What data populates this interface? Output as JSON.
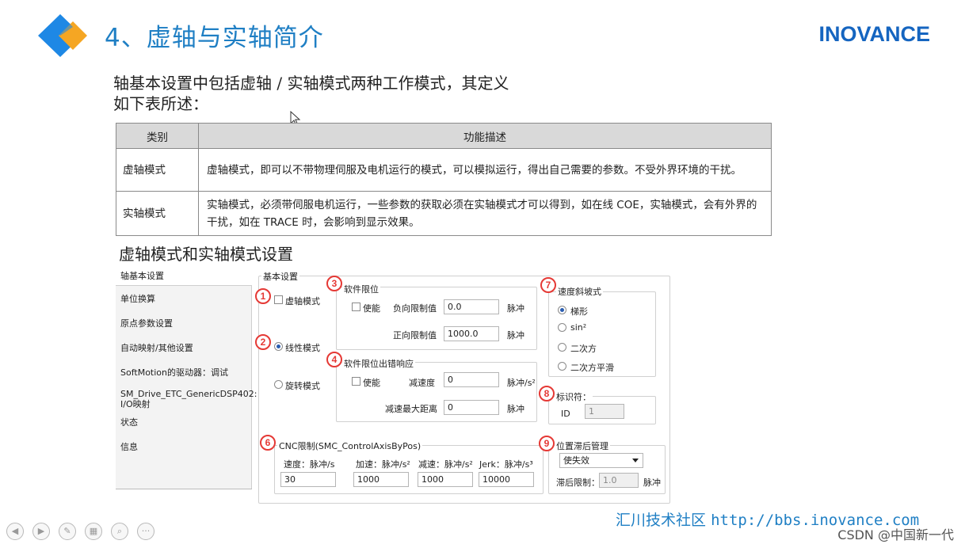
{
  "slide": {
    "title": "4、虚轴与实轴简介",
    "brand": "INOVANCE",
    "intro_line1": "轴基本设置中包括虚轴 / 实轴模式两种工作模式，其定义",
    "intro_line2": "如下表所述：",
    "subtitle": "虚轴模式和实轴模式设置",
    "footer_text": "汇川技术社区",
    "footer_url": "http://bbs.inovance.com",
    "watermark": "CSDN @中国新一代",
    "colors": {
      "title": "#1f7fc4",
      "brand": "#1565c0",
      "diamond_blue": "#1e88e5",
      "diamond_orange": "#f5a623",
      "badge": "#e53935"
    }
  },
  "table": {
    "headers": [
      "类别",
      "功能描述"
    ],
    "rows": [
      {
        "category": "虚轴模式",
        "desc": "虚轴模式，即可以不带物理伺服及电机运行的模式，可以模拟运行，得出自己需要的参数。不受外界环境的干扰。"
      },
      {
        "category": "实轴模式",
        "desc": "实轴模式，必须带伺服电机运行，一些参数的获取必须在实轴模式才可以得到，如在线 COE，实轴模式，会有外界的干扰，如在 TRACE 时，会影响到显示效果。"
      }
    ]
  },
  "settings": {
    "nav_header": "轴基本设置",
    "nav_items": [
      "单位换算",
      "原点参数设置",
      "自动映射/其他设置",
      "SoftMotion的驱动器：调试",
      "SM_Drive_ETC_GenericDSP402: I/O映射",
      "状态",
      "信息"
    ],
    "basic_legend": "基本设置",
    "virtual_mode": "虚轴模式",
    "linear_mode": "线性模式",
    "rotary_mode": "旋转模式",
    "soft_limit": {
      "legend": "软件限位",
      "enable": "使能",
      "neg_label": "负向限制值",
      "neg_value": "0.0",
      "pos_label": "正向限制值",
      "pos_value": "1000.0",
      "unit": "脉冲"
    },
    "limit_error": {
      "legend": "软件限位出错响应",
      "enable": "使能",
      "decel_label": "减速度",
      "decel_value": "0",
      "decel_unit": "脉冲/s²",
      "maxdist_label": "减速最大距离",
      "maxdist_value": "0",
      "maxdist_unit": "脉冲"
    },
    "ramp": {
      "legend": "速度斜坡式",
      "options": [
        "梯形",
        "sin²",
        "二次方",
        "二次方平滑"
      ],
      "selected": 0
    },
    "identifier": {
      "legend": "标识符：",
      "id_label": "ID",
      "id_value": "1"
    },
    "cnc": {
      "legend": "CNC限制(SMC_ControlAxisByPos)",
      "speed_label": "速度：脉冲/s",
      "speed_value": "30",
      "accel_label": "加速：脉冲/s²",
      "accel_value": "1000",
      "decel_label": "减速：脉冲/s²",
      "decel_value": "1000",
      "jerk_label": "Jerk：脉冲/s³",
      "jerk_value": "10000"
    },
    "lag": {
      "legend": "位置滞后管理",
      "selected": "使失效",
      "limit_label": "滞后限制：",
      "limit_value": "1.0",
      "unit": "脉冲"
    },
    "badges": [
      "1",
      "2",
      "3",
      "4",
      "6",
      "7",
      "8",
      "9"
    ]
  }
}
